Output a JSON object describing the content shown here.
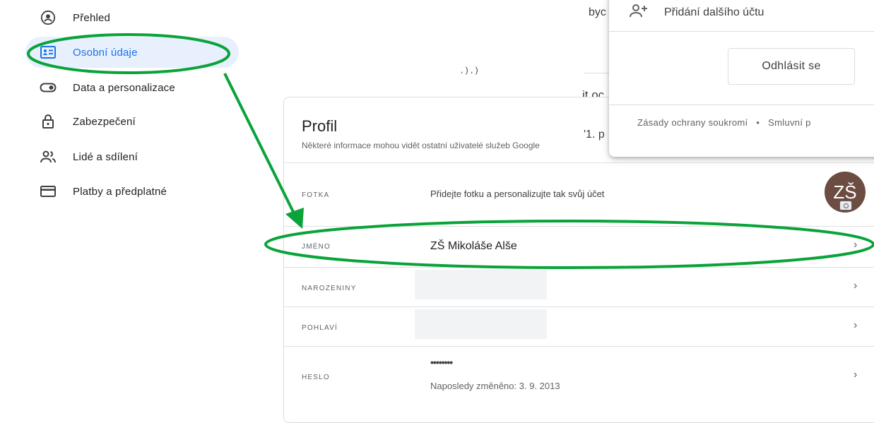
{
  "sidebar": {
    "items": [
      {
        "label": "Přehled",
        "icon": "account-circle-icon",
        "active": false
      },
      {
        "label": "Osobní údaje",
        "icon": "id-card-icon",
        "active": true
      },
      {
        "label": "Data a personalizace",
        "icon": "toggle-icon",
        "active": false
      },
      {
        "label": "Zabezpečení",
        "icon": "lock-icon",
        "active": false
      },
      {
        "label": "Lidé a sdílení",
        "icon": "people-icon",
        "active": false
      },
      {
        "label": "Platby a předplatné",
        "icon": "credit-card-icon",
        "active": false
      }
    ]
  },
  "background_fragments": {
    "frag1": "byc",
    "frag2": "it oc",
    "frag3": "'1. p",
    "frag4": ", ) , )"
  },
  "profile": {
    "title": "Profil",
    "subtitle": "Některé informace mohou vidět ostatní uživatelé služeb Google",
    "photo": {
      "label": "FOTKA",
      "text": "Přidejte fotku a personalizujte tak svůj účet",
      "avatar_initials": "ZŠ"
    },
    "name": {
      "label": "JMÉNO",
      "value": "ZŠ Mikoláše Alše"
    },
    "birthday": {
      "label": "NAROZENINY"
    },
    "gender": {
      "label": "POHLAVÍ"
    },
    "password": {
      "label": "HESLO",
      "value": "••••••••",
      "changed": "Naposledy změněno: 3. 9. 2013"
    }
  },
  "account_popup": {
    "add_account": "Přidání dalšího účtu",
    "sign_out": "Odhlásit se",
    "privacy": "Zásady ochrany soukromí",
    "separator": "•",
    "terms": "Smluvní p"
  },
  "colors": {
    "accent": "#1a73e8",
    "active_bg": "#e8f0fe",
    "annotation": "#0aa33a"
  }
}
